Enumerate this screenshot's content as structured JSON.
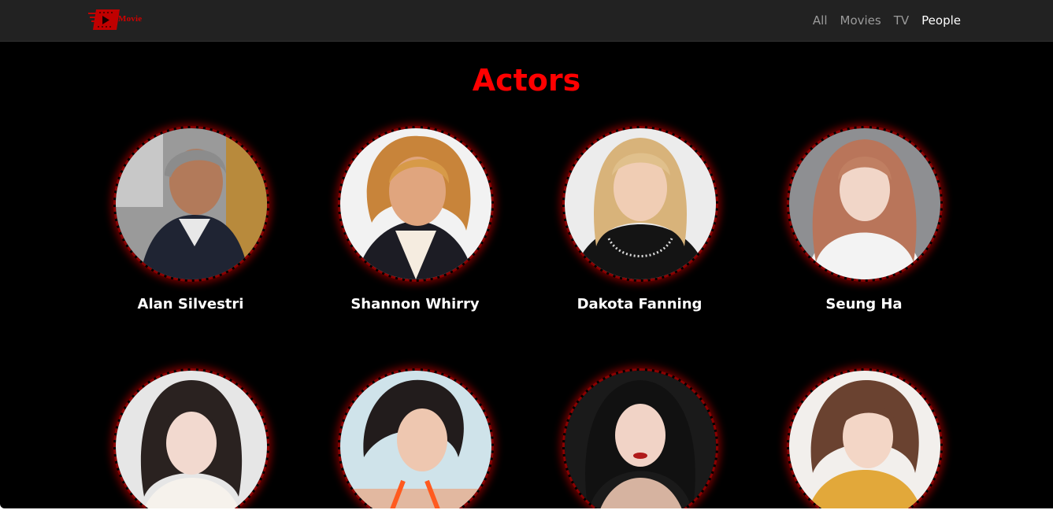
{
  "brand": {
    "logo_text": "Movie",
    "accent_color": "#e00000"
  },
  "nav": {
    "items": [
      {
        "label": "All",
        "active": false
      },
      {
        "label": "Movies",
        "active": false
      },
      {
        "label": "TV",
        "active": false
      },
      {
        "label": "People",
        "active": true
      }
    ]
  },
  "main": {
    "title": "Actors",
    "actors": [
      {
        "name": "Alan Silvestri",
        "photo": "actor-photo-icon"
      },
      {
        "name": "Shannon Whirry",
        "photo": "actor-photo-icon"
      },
      {
        "name": "Dakota Fanning",
        "photo": "actor-photo-icon"
      },
      {
        "name": "Seung Ha",
        "photo": "actor-photo-icon"
      },
      {
        "name": "",
        "photo": "actor-photo-icon"
      },
      {
        "name": "",
        "photo": "actor-photo-icon"
      },
      {
        "name": "",
        "photo": "actor-photo-icon"
      },
      {
        "name": "",
        "photo": "actor-photo-icon"
      }
    ]
  },
  "colors": {
    "page_background": "#000000",
    "navbar_background": "#222222",
    "title_color": "#ff0000",
    "nav_inactive": "#9b9b9b",
    "nav_active": "#ffffff",
    "avatar_border": "#8a0000"
  }
}
